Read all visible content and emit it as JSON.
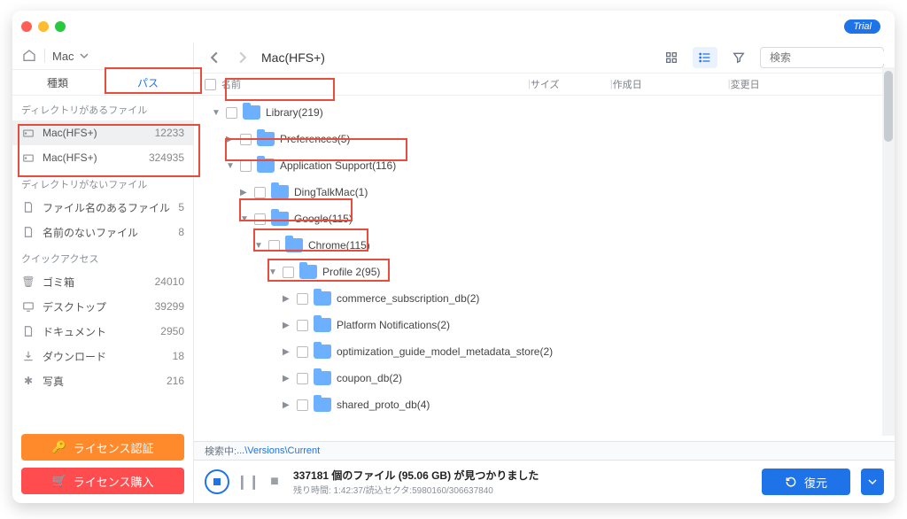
{
  "brand": {
    "trial_label": "Trial"
  },
  "crumb": {
    "selected": "Mac"
  },
  "tabs": {
    "kind": "種類",
    "path": "パス"
  },
  "sections": {
    "with_dir": "ディレクトリがあるファイル",
    "without_dir": "ディレクトリがないファイル",
    "quick": "クイックアクセス"
  },
  "sidebar": {
    "with_dir": [
      {
        "label": "Mac(HFS+)",
        "count": "12233"
      },
      {
        "label": "Mac(HFS+)",
        "count": "324935"
      }
    ],
    "without_dir": [
      {
        "label": "ファイル名のあるファイル",
        "count": "5"
      },
      {
        "label": "名前のないファイル",
        "count": "8"
      }
    ],
    "quick": [
      {
        "label": "ゴミ箱",
        "count": "24010"
      },
      {
        "label": "デスクトップ",
        "count": "39299"
      },
      {
        "label": "ドキュメント",
        "count": "2950"
      },
      {
        "label": "ダウンロード",
        "count": "18"
      },
      {
        "label": "写真",
        "count": "216"
      }
    ]
  },
  "sidebar_buttons": {
    "license": "ライセンス認証",
    "purchase": "ライセンス購入"
  },
  "toolbar": {
    "path_title": "Mac(HFS+)",
    "search_placeholder": "検索"
  },
  "columns": {
    "name": "名前",
    "size": "サイズ",
    "created": "作成日",
    "modified": "変更日"
  },
  "tree": [
    {
      "indent": 0,
      "expanded": true,
      "label": "Library(219)"
    },
    {
      "indent": 1,
      "expanded": false,
      "label": "Preferences(5)"
    },
    {
      "indent": 1,
      "expanded": true,
      "label": "Application Support(116)"
    },
    {
      "indent": 2,
      "expanded": false,
      "label": "DingTalkMac(1)"
    },
    {
      "indent": 2,
      "expanded": true,
      "label": "Google(115)"
    },
    {
      "indent": 3,
      "expanded": true,
      "label": "Chrome(115)"
    },
    {
      "indent": 4,
      "expanded": true,
      "label": "Profile 2(95)"
    },
    {
      "indent": 5,
      "expanded": false,
      "label": "commerce_subscription_db(2)"
    },
    {
      "indent": 5,
      "expanded": false,
      "label": "Platform Notifications(2)"
    },
    {
      "indent": 5,
      "expanded": false,
      "label": "optimization_guide_model_metadata_store(2)"
    },
    {
      "indent": 5,
      "expanded": false,
      "label": "coupon_db(2)"
    },
    {
      "indent": 5,
      "expanded": false,
      "label": "shared_proto_db(4)"
    }
  ],
  "status": {
    "prefix": "検索中:",
    "path": "...\\Versions\\Current"
  },
  "footer": {
    "headline": "337181 個のファイル (95.06 GB) が見つかりました",
    "sub": "残り時間: 1:42:37/読込セクタ:5980160/306637840",
    "restore": "復元"
  }
}
